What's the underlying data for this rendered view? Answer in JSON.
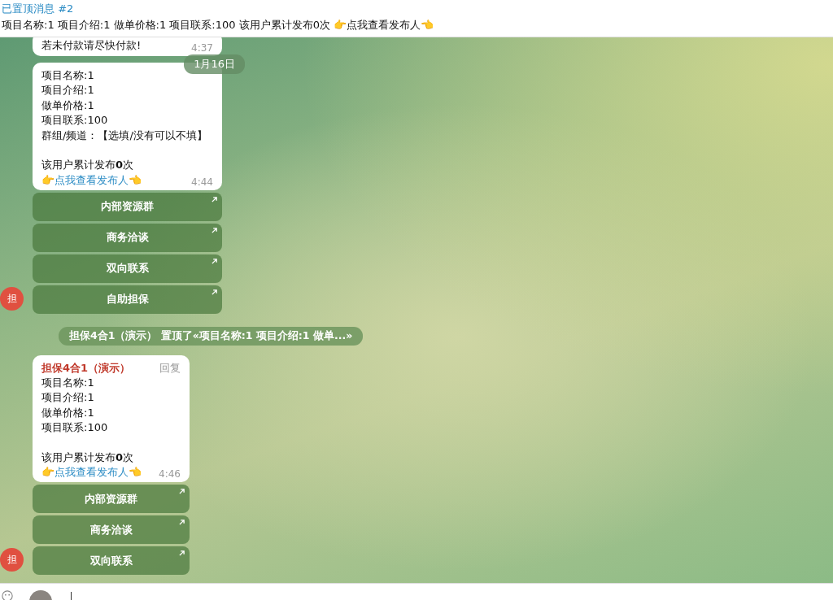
{
  "pinned": {
    "title": "已置顶消息 #2",
    "text": "项目名称:1 项目介绍:1 做单价格:1 项目联系:100  该用户累计发布0次 👉点我查看发布人👈"
  },
  "messages": [
    {
      "kind": "message",
      "lines": [
        "若未付款请尽快付款!"
      ],
      "time": "4:37"
    },
    {
      "kind": "date",
      "text": "1月16日"
    },
    {
      "kind": "message",
      "lines": [
        "项目名称:1",
        "项目介绍:1",
        "做单价格:1",
        "项目联系:100",
        "群组/频道：【选填/没有可以不填】"
      ],
      "stats": "该用户累计发布**0**次",
      "link": "👉点我查看发布人👈",
      "time": "4:44",
      "avatar": "担",
      "buttons": [
        "内部资源群",
        "商务洽谈",
        "双向联系",
        "自助担保"
      ]
    },
    {
      "kind": "service",
      "text": "担保4合1（演示） 置顶了«项目名称:1 项目介绍:1 做单...»"
    },
    {
      "kind": "message",
      "sender": "担保4合1（演示）",
      "reply": "回复",
      "lines": [
        "项目名称:1",
        "项目介绍:1",
        "做单价格:1",
        "项目联系:100"
      ],
      "stats": "该用户累计发布**0**次",
      "link": "👉点我查看发布人👈",
      "time": "4:46",
      "avatar": "担",
      "buttons": [
        "内部资源群",
        "商务洽谈",
        "双向联系"
      ]
    }
  ]
}
